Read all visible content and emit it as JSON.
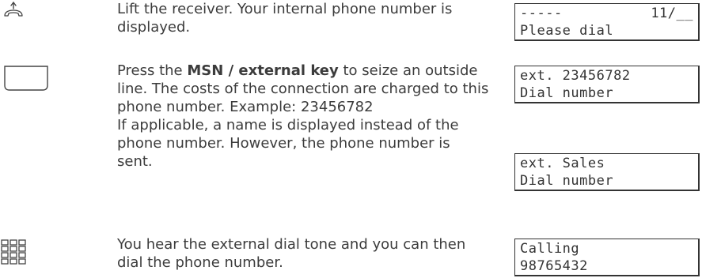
{
  "steps": [
    {
      "icon": "handset-lift-icon",
      "text": "Lift the receiver. Your internal phone number is displayed.",
      "display": {
        "line1_left": "-----",
        "line1_right": "11/__",
        "line2": "Please dial"
      }
    },
    {
      "icon": "key-icon",
      "text_pre": "Press the ",
      "text_bold": "MSN / external key",
      "text_post": " to seize an outside line. The costs of the connection are charged to this phone number. Example: 23456782",
      "text_extra": "If applicable, a name is displayed instead of the phone number. However, the phone number is sent.",
      "display": {
        "line1": "ext. 23456782",
        "line2": "Dial number"
      },
      "display_alt": {
        "line1": "ext. Sales",
        "line2": "Dial number"
      }
    },
    {
      "icon": "keypad-icon",
      "text": "You hear the external dial tone and you can then dial the phone number.",
      "display": {
        "line1": "Calling",
        "line2": "98765432"
      }
    }
  ]
}
